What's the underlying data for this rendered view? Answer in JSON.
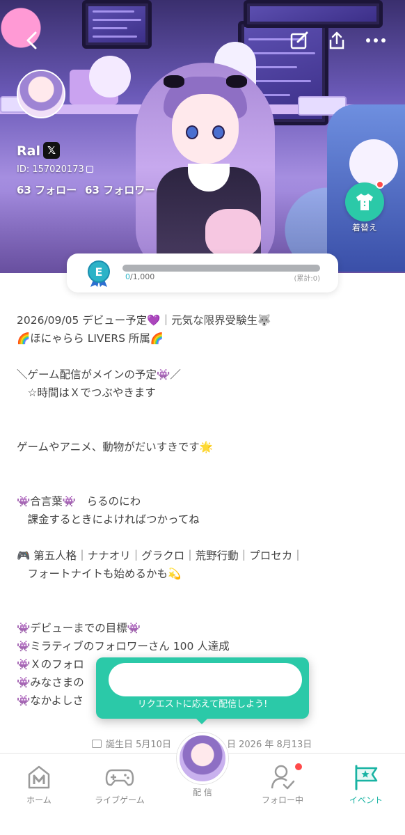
{
  "header": {
    "user_name": "Ral",
    "x_badge": "𝕏",
    "user_id": "ID: 157020173",
    "following": "63 フォロー",
    "followers": "63 フォロワー",
    "dress_up_label": "着替え"
  },
  "level": {
    "badge_letter": "E",
    "progress_current": "0",
    "progress_rest": "/1,000",
    "total": "(累計:0)",
    "fill_fraction": 0
  },
  "bio": {
    "lines": [
      "2026/09/05 デビュー予定💜｜元気な限界受験生🐺",
      "🌈ほにゃらら LIVERS 所属🌈",
      "",
      "＼ゲーム配信がメインの予定👾／",
      "　☆時間はＸでつぶやきます",
      "",
      "",
      "ゲームやアニメ、動物がだいすきです🌟",
      "",
      "",
      "👾合言葉👾　らるのにわ",
      "　課金するときによければつかってね",
      "",
      "🎮 第五人格｜ナナオリ｜グラクロ｜荒野行動｜プロセカ｜",
      "　フォートナイトも始めるかも💫",
      "",
      "",
      "👾デビューまでの目標👾",
      "👾ミラティブのフォロワーさん 100 人達成",
      "👾Ｘのフォロ",
      "👾みなさまの",
      "👾なかよしさ"
    ]
  },
  "toast": {
    "message": "リクエストに応えて配信しよう!"
  },
  "info": {
    "birthday": "誕生日 5月10日",
    "debut": "日 2026 年 8月13日"
  },
  "nav": {
    "home": "ホーム",
    "live_game": "ライブゲーム",
    "stream": "配 信",
    "following": "フォロー中",
    "event": "イベント"
  },
  "colors": {
    "accent": "#2bc9a8",
    "active_tab": "#19b3a3",
    "notification": "#ff4a4a"
  }
}
